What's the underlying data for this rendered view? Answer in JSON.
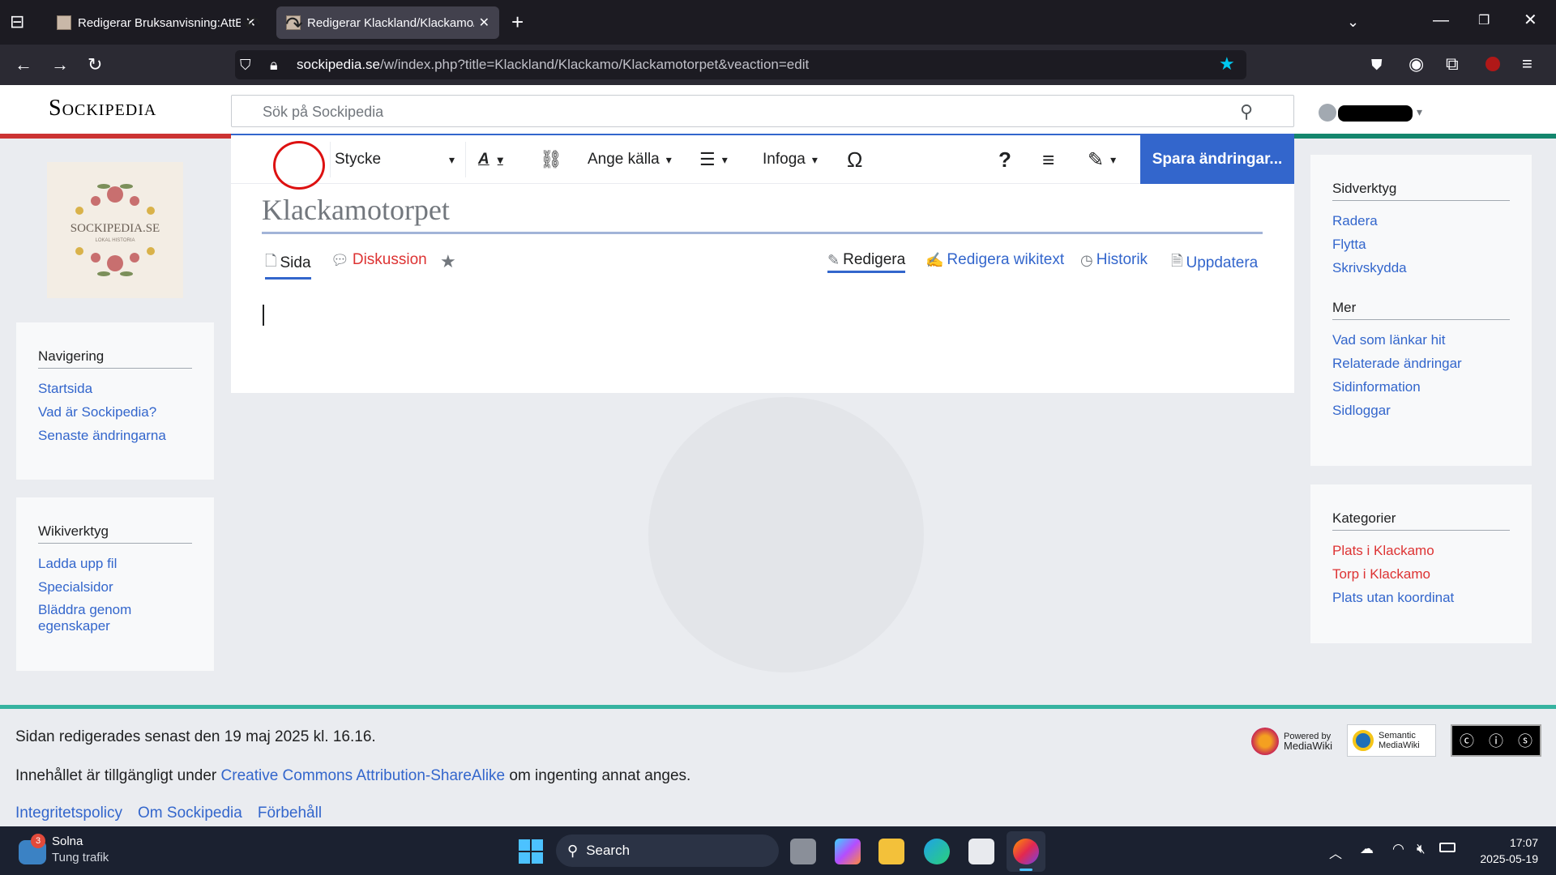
{
  "browser": {
    "tabs": [
      {
        "title": "Redigerar Bruksanvisning:AttBid"
      },
      {
        "title": "Redigerar Klackland/Klackamo/K"
      }
    ],
    "url_domain": "sockipedia.se",
    "url_path": "/w/index.php?title=Klackland/Klackamo/Klackamotorpet&veaction=edit"
  },
  "site": {
    "logo": "Sockipedia",
    "search_placeholder": "Sök på Sockipedia",
    "logo_image_text": "SOCKIPEDIA.SE",
    "logo_image_sub": "LOKAL HISTORIA"
  },
  "toolbar": {
    "paragraph": "Stycke",
    "cite": "Ange källa",
    "insert": "Infoga",
    "save": "Spara ändringar..."
  },
  "page": {
    "title": "Klackamotorpet",
    "tabs": {
      "page": "Sida",
      "talk": "Diskussion",
      "edit": "Redigera",
      "edit_source": "Redigera wikitext",
      "history": "Historik",
      "purge": "Uppdatera"
    }
  },
  "left_sidebar": {
    "navigation": {
      "title": "Navigering",
      "items": [
        "Startsida",
        "Vad är Sockipedia?",
        "Senaste ändringarna"
      ]
    },
    "tools": {
      "title": "Wikiverktyg",
      "items": [
        "Ladda upp fil",
        "Specialsidor",
        "Bläddra genom egenskaper"
      ]
    }
  },
  "right_sidebar": {
    "page_tools": {
      "title": "Sidverktyg",
      "items": [
        "Radera",
        "Flytta",
        "Skrivskydda"
      ]
    },
    "more": {
      "title": "Mer",
      "items": [
        "Vad som länkar hit",
        "Relaterade ändringar",
        "Sidinformation",
        "Sidloggar"
      ]
    },
    "categories": {
      "title": "Kategorier",
      "items": [
        "Plats i Klackamo",
        "Torp i Klackamo",
        "Plats utan koordinat"
      ]
    }
  },
  "footer": {
    "last_edited": "Sidan redigerades senast den 19 maj 2025 kl. 16.16.",
    "license_prefix": "Innehållet är tillgängligt under ",
    "license_link": "Creative Commons Attribution-ShareAlike",
    "license_suffix": " om ingenting annat anges.",
    "links": [
      "Integritetspolicy",
      "Om Sockipedia",
      "Förbehåll"
    ],
    "badge_mw_line1": "Powered by",
    "badge_mw_line2": "MediaWiki",
    "badge_smw_line1": "Semantic",
    "badge_smw_line2": "MediaWiki"
  },
  "taskbar": {
    "weather_city": "Solna",
    "weather_status": "Tung trafik",
    "weather_badge": "3",
    "search": "Search",
    "time": "17:07",
    "date": "2025-05-19"
  },
  "colors": {
    "link": "#3366cc",
    "redlink": "#dd3333",
    "accent": "#3366cc"
  }
}
